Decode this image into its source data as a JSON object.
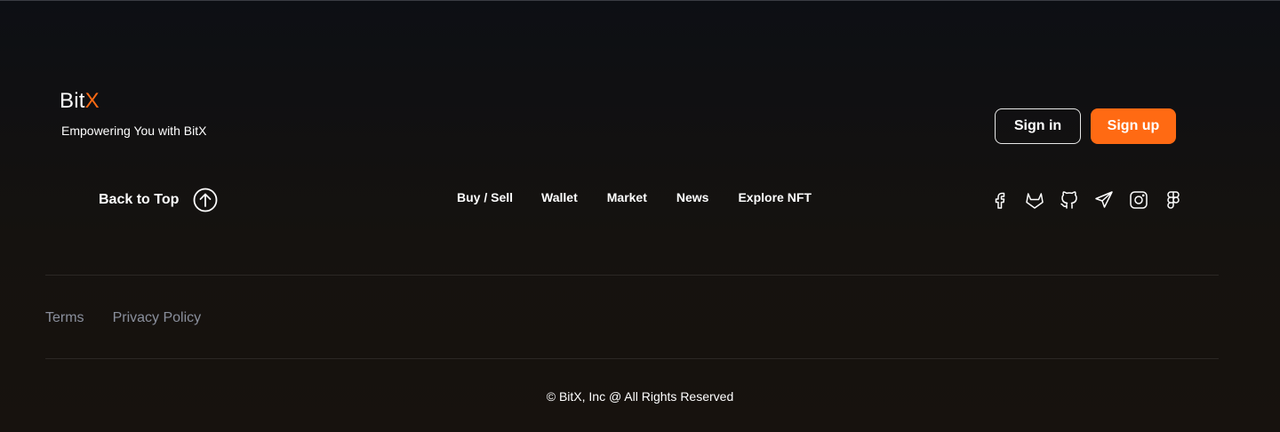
{
  "brand": {
    "logo_main": "Bit",
    "logo_accent": "X",
    "tagline": "Empowering You with BitX",
    "accent_color": "#ff6a13"
  },
  "auth": {
    "sign_in_label": "Sign in",
    "sign_up_label": "Sign up"
  },
  "back_to_top": {
    "label": "Back to Top",
    "icon": "arrow-up-circle-icon"
  },
  "nav": {
    "items": [
      {
        "label": "Buy / Sell"
      },
      {
        "label": "Wallet"
      },
      {
        "label": "Market"
      },
      {
        "label": "News"
      },
      {
        "label": "Explore NFT"
      }
    ]
  },
  "social": {
    "icons": [
      "facebook-icon",
      "gitlab-icon",
      "github-icon",
      "telegram-icon",
      "instagram-icon",
      "figma-icon"
    ]
  },
  "legal": {
    "terms_label": "Terms",
    "privacy_label": "Privacy Policy"
  },
  "footer": {
    "copyright": "© BitX, Inc @ All Rights Reserved"
  }
}
